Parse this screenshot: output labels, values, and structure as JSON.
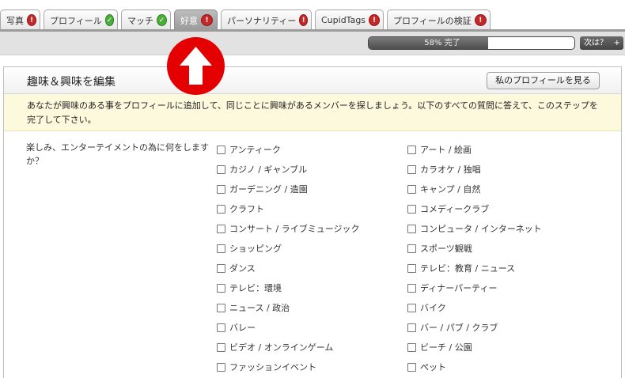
{
  "tabs": [
    {
      "label": "写真",
      "status": "error",
      "active": false
    },
    {
      "label": "プロフィール",
      "status": "ok",
      "active": false
    },
    {
      "label": "マッチ",
      "status": "ok",
      "active": false
    },
    {
      "label": "好意",
      "status": "error",
      "active": true
    },
    {
      "label": "パーソナリティー",
      "status": "error",
      "active": false
    },
    {
      "label": "CupidTags",
      "status": "error",
      "active": false
    },
    {
      "label": "プロフィールの検証",
      "status": "error",
      "active": false
    }
  ],
  "status_glyphs": {
    "error": "!",
    "ok": "✓"
  },
  "colors": {
    "error": "#c62727",
    "ok": "#4cae3a",
    "notice_bg": "#fcf9dd",
    "marker": "#e40000"
  },
  "progress": {
    "percent": 58,
    "label": "58% 完了"
  },
  "next_label": "次は？",
  "next_plus": "+",
  "panel": {
    "title": "趣味＆興味を編集",
    "view_profile_button": "私のプロフィールを見る",
    "notice": "あなたが興味のある事をプロフィールに追加して、同じことに興味があるメンバーを探しましょう。以下のすべての質問に答えて、このステップを完了して下さい。"
  },
  "question": "楽しみ、エンターテイメントの為に何をしますか？",
  "options_left": [
    "アンティーク",
    "カジノ / ギャンブル",
    "ガーデニング / 造園",
    "クラフト",
    "コンサート / ライブミュージック",
    "ショッピング",
    "ダンス",
    "テレビ：環境",
    "ニュース / 政治",
    "バレー",
    "ビデオ / オンラインゲーム",
    "ファッションイベント"
  ],
  "options_right": [
    "アート / 絵画",
    "カラオケ / 独唱",
    "キャンプ / 自然",
    "コメディークラブ",
    "コンピュータ / インターネット",
    "スポーツ観戦",
    "テレビ：教育 / ニュース",
    "ディナーパーティー",
    "バイク",
    "バー / パブ / クラブ",
    "ビーチ / 公園",
    "ペット"
  ]
}
